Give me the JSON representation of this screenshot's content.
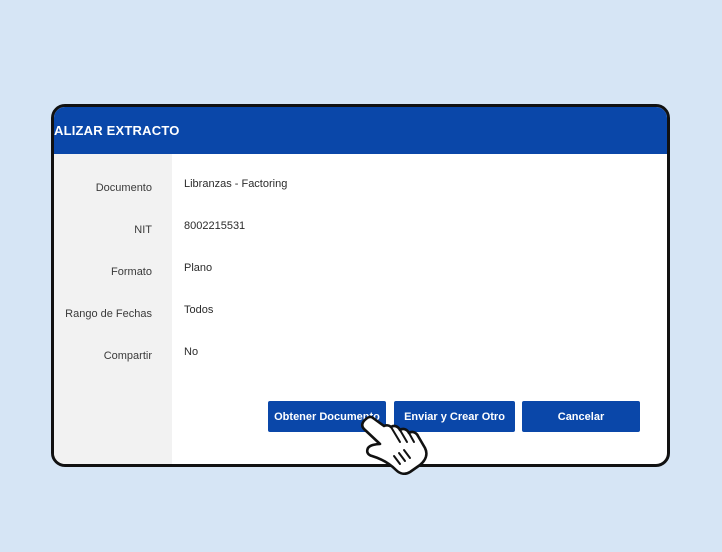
{
  "dialog": {
    "title": "ALIZAR EXTRACTO"
  },
  "fields": [
    {
      "label": "Documento",
      "value": "Libranzas - Factoring"
    },
    {
      "label": "NIT",
      "value": "8002215531"
    },
    {
      "label": "Formato",
      "value": "Plano"
    },
    {
      "label": "Rango de Fechas",
      "value": "Todos"
    },
    {
      "label": "Compartir",
      "value": "No"
    }
  ],
  "buttons": {
    "get_document": "Obtener Documento",
    "send_and_create": "Enviar y Crear Otro",
    "cancel": "Cancelar"
  },
  "colors": {
    "accent": "#0a47a9",
    "background": "#d6e5f5",
    "label_column": "#f2f2f2"
  },
  "cursor_icon": "hand-pointer-icon"
}
